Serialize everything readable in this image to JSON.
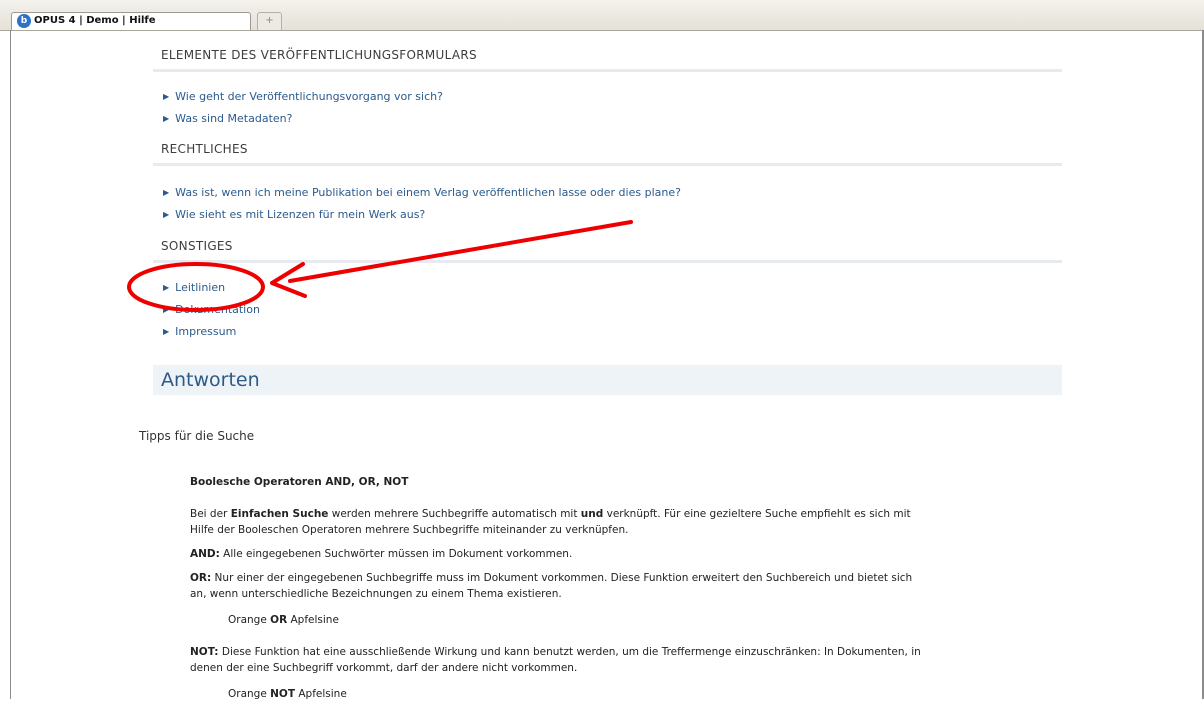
{
  "browser": {
    "tab_title": "OPUS 4 | Demo | Hilfe",
    "new_tab_symbol": "+"
  },
  "sections": [
    {
      "heading": "ELEMENTE DES VERÖFFENTLICHUNGSFORMULARS",
      "links": [
        "Wie geht der Veröffentlichungsvorgang vor sich?",
        "Was sind Metadaten?"
      ]
    },
    {
      "heading": "RECHTLICHES",
      "links": [
        "Was ist, wenn ich meine Publikation bei einem Verlag veröffentlichen lasse oder dies plane?",
        "Wie sieht es mit Lizenzen für mein Werk aus?"
      ]
    },
    {
      "heading": "SONSTIGES",
      "links": [
        "Leitlinien",
        "Dokumentation",
        "Impressum"
      ]
    }
  ],
  "answers": {
    "title": "Antworten",
    "subtitle": "Tipps für die Suche",
    "boolean_heading": "Boolesche Operatoren AND, OR, NOT",
    "p1_a": "Bei der ",
    "p1_b": "Einfachen Suche",
    "p1_c": " werden mehrere Suchbegriffe automatisch mit ",
    "p1_d": "und",
    "p1_e": " verknüpft. Für eine gezieltere Suche empfiehlt es sich mit",
    "p1_line2": "Hilfe der Booleschen Operatoren mehrere Suchbegriffe miteinander zu verknüpfen.",
    "and_label": "AND:",
    "and_text": " Alle eingegebenen Suchwörter müssen im Dokument vorkommen.",
    "or_label": "OR:",
    "or_text": " Nur einer der eingegebenen Suchbegriffe muss im Dokument vorkommen. Diese Funktion erweitert den Suchbereich und bietet sich",
    "or_line2": "an, wenn unterschiedliche Bezeichnungen zu einem Thema existieren.",
    "or_example_a": "Orange ",
    "or_example_op": "OR",
    "or_example_b": " Apfelsine",
    "not_label": "NOT:",
    "not_text": " Diese Funktion hat eine ausschließende Wirkung und kann benutzt werden, um die Treffermenge einzuschränken: In Dokumenten, in",
    "not_line2": "denen der eine Suchbegriff vorkommt, darf der andere nicht vorkommen.",
    "not_example_a": "Orange ",
    "not_example_op": "NOT",
    "not_example_b": " Apfelsine"
  },
  "annotation": {
    "color": "#ee0000"
  }
}
